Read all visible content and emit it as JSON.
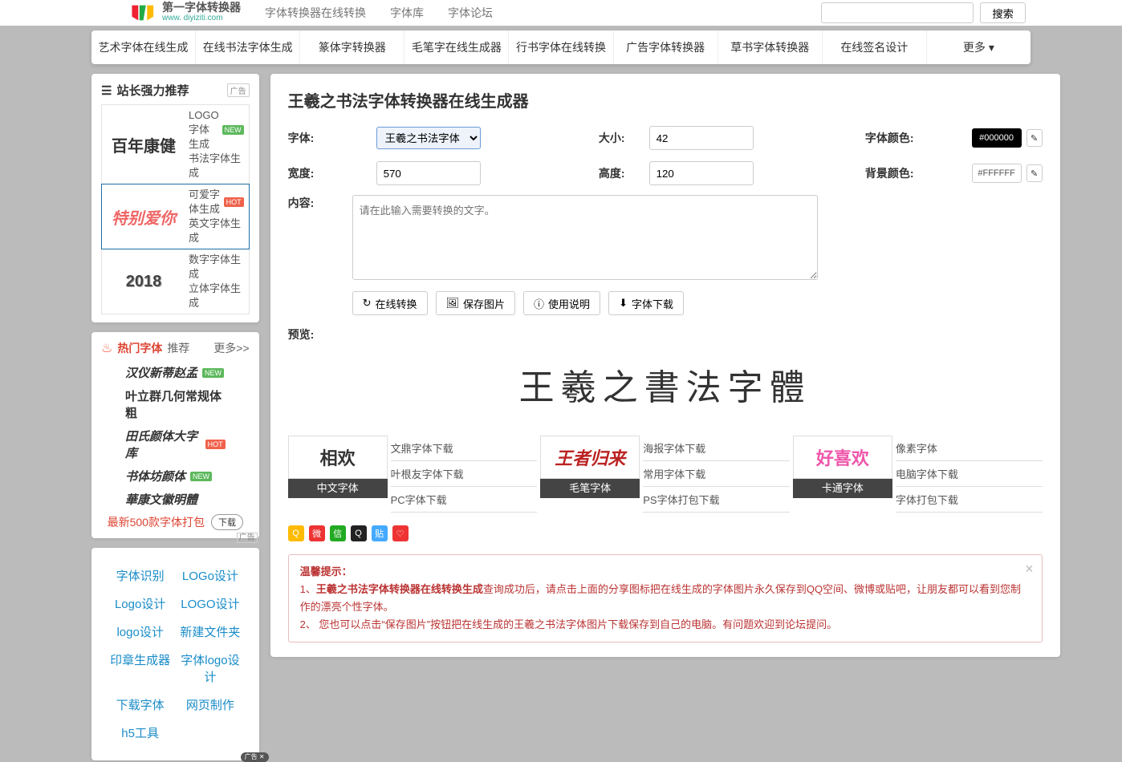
{
  "site": {
    "domain": "www. diyiziti.com"
  },
  "top_links": [
    "字体转换器在线转换",
    "字体库",
    "字体论坛"
  ],
  "search": {
    "placeholder": "",
    "button": "搜索"
  },
  "nav": [
    "艺术字体在线生成",
    "在线书法字体生成",
    "篆体字转换器",
    "毛笔字在线生成器",
    "行书字体在线转换",
    "广告字体转换器",
    "草书字体转换器",
    "在线签名设计"
  ],
  "nav_more": "更多",
  "rec": {
    "title": "站长强力推荐",
    "ad": "广告",
    "items": [
      {
        "thumb": "百年康健",
        "l1": "LOGO字体生成",
        "l2": "书法字体生成",
        "badge": "NEW",
        "badgeCls": "new"
      },
      {
        "thumb": "特别爱你",
        "l1": "可爱字体生成",
        "l2": "英文字体生成",
        "badge": "HOT",
        "badgeCls": "hot"
      },
      {
        "thumb": "2018",
        "l1": "数字字体生成",
        "l2": "立体字体生成",
        "badge": "",
        "badgeCls": ""
      }
    ]
  },
  "hot": {
    "title": "热门字体",
    "sub": "推荐",
    "more": "更多>>",
    "ad": "广告",
    "items": [
      {
        "name": "汉仪新蒂赵孟",
        "badge": "NEW",
        "cls": "new"
      },
      {
        "name": "叶立群几何常规体粗",
        "badge": "",
        "cls": ""
      },
      {
        "name": "田氏颜体大字库",
        "badge": "HOT",
        "cls": "hot"
      },
      {
        "name": "书体坊颜体",
        "badge": "NEW",
        "cls": "new"
      },
      {
        "name": "華康文徽明體",
        "badge": "",
        "cls": ""
      }
    ],
    "bottom": "最新500款字体打包",
    "dl": "下载"
  },
  "quick_links": [
    "字体识别",
    "LOGo设计",
    "Logo设计",
    "LOGO设计",
    "logo设计",
    "新建文件夹",
    "印章生成器",
    "字体logo设计",
    "下载字体",
    "网页制作",
    "h5工具"
  ],
  "pill_label": "广告",
  "page_title": "王羲之书法字体转换器在线生成器",
  "form": {
    "font_lbl": "字体:",
    "font_val": "王羲之书法字体",
    "size_lbl": "大小:",
    "size_val": "42",
    "fc_lbl": "字体颜色:",
    "fc_val": "#000000",
    "w_lbl": "宽度:",
    "w_val": "570",
    "h_lbl": "高度:",
    "h_val": "120",
    "bg_lbl": "背景颜色:",
    "bg_val": "#FFFFFF",
    "content_lbl": "内容:",
    "content_ph": "请在此输入需要转换的文字。"
  },
  "buttons": {
    "convert": "在线转换",
    "save": "保存图片",
    "help": "使用说明",
    "download": "字体下载"
  },
  "preview_lbl": "预览:",
  "preview_text": "王羲之書法字體",
  "cards": [
    {
      "img": "相欢",
      "cap": "中文字体",
      "l1": "文鼎字体下载",
      "l2": "叶根友字体下载",
      "l3": "PC字体下载"
    },
    {
      "img": "王者归来",
      "cap": "毛笔字体",
      "l1": "海报字体下载",
      "l2": "常用字体下载",
      "l3": "PS字体打包下载"
    },
    {
      "img": "好喜欢",
      "cap": "卡通字体",
      "l1": "像素字体",
      "l2": "电脑字体下载",
      "l3": "字体打包下载"
    }
  ],
  "tip": {
    "head": "温馨提示：",
    "l1_a": "1、",
    "l1_b": "王羲之书法字体转换器在线转换生成",
    "l1_c": "查询成功后，请点击上面的分享图标把在线生成的字体图片永久保存到QQ空间、微博或贴吧，让朋友都可以看到您制作的漂亮个性字体。",
    "l2": "2、 您也可以点击“保存图片”按钮把在线生成的王羲之书法字体图片下载保存到自己的电脑。有问题欢迎到论坛提问。"
  }
}
